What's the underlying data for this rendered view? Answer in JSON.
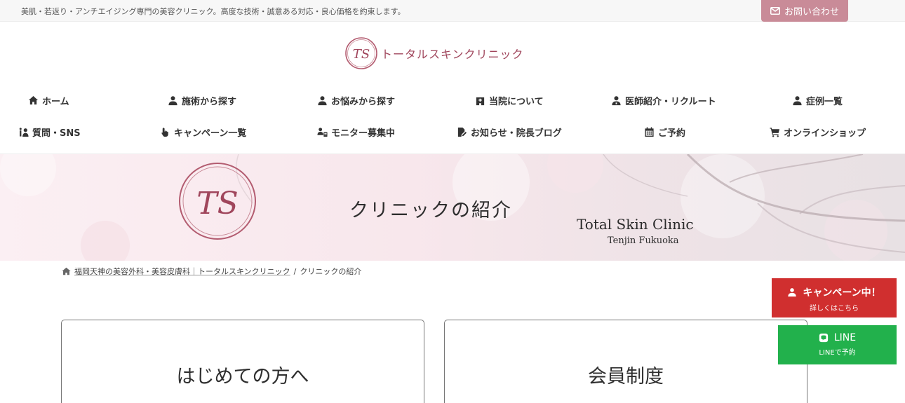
{
  "topbar": {
    "tagline": "美肌・若返り・アンチエイジング専門の美容クリニック。高度な技術・誠意ある対応・良心価格を約束します。",
    "contact_label": "お問い合わせ"
  },
  "logo": {
    "monogram": "TS",
    "text": "トータルスキンクリニック"
  },
  "nav": {
    "row1": [
      {
        "label": "ホーム",
        "icon": "home-icon"
      },
      {
        "label": "施術から探す",
        "icon": "user-nurse-icon"
      },
      {
        "label": "お悩みから探す",
        "icon": "user-nurse-icon"
      },
      {
        "label": "当院について",
        "icon": "hospital-icon"
      },
      {
        "label": "医師紹介・リクルート",
        "icon": "user-md-icon"
      },
      {
        "label": "症例一覧",
        "icon": "user-nurse-icon"
      }
    ],
    "row2": [
      {
        "label": "質問・SNS",
        "icon": "info-user-icon"
      },
      {
        "label": "キャンペーン一覧",
        "icon": "hand-pointer-icon"
      },
      {
        "label": "モニター募集中",
        "icon": "id-card-icon"
      },
      {
        "label": "お知らせ・院長ブログ",
        "icon": "file-edit-icon"
      },
      {
        "label": "ご予約",
        "icon": "calendar-icon"
      },
      {
        "label": "オンラインショップ",
        "icon": "cart-icon"
      }
    ]
  },
  "hero": {
    "monogram": "TS",
    "title": "クリニックの紹介",
    "subtitle1": "Total Skin Clinic",
    "subtitle2": "Tenjin Fukuoka"
  },
  "breadcrumb": {
    "home_label": "福岡天神の美容外科・美容皮膚科｜トータルスキンクリニック",
    "separator": "/",
    "current": "クリニックの紹介"
  },
  "cards": [
    {
      "title": "はじめての方へ"
    },
    {
      "title": "会員制度"
    }
  ],
  "floating": {
    "campaign": {
      "main": "キャンペーン中！",
      "sub": "詳しくはこちら",
      "color": "#d02f2f"
    },
    "line": {
      "main": "LINE",
      "sub": "LINEで予約",
      "color": "#22b14c"
    }
  },
  "colors": {
    "accent": "#c98b98",
    "brand": "#a0465c"
  }
}
